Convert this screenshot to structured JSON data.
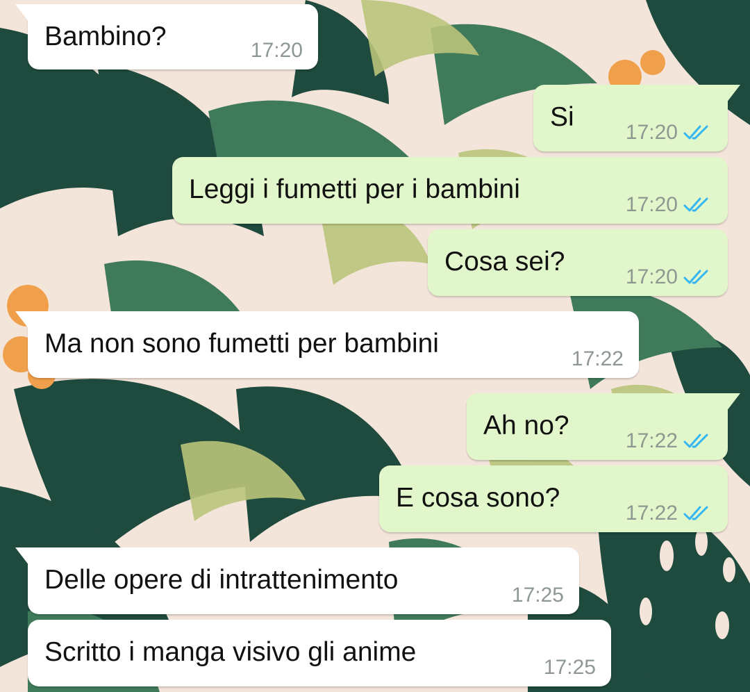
{
  "theme": {
    "incoming_bubble": "#ffffff",
    "outgoing_bubble": "#e1f7cb",
    "read_tick_color": "#34b7f1",
    "timestamp_color": "#8f9890"
  },
  "messages": [
    {
      "direction": "incoming",
      "text": "Bambino?",
      "time": "17:20",
      "status_icon": "double-check-read-icon"
    },
    {
      "direction": "outgoing",
      "text": "Si",
      "time": "17:20",
      "status_icon": "double-check-read-icon"
    },
    {
      "direction": "outgoing",
      "text": "Leggi i fumetti per i bambini",
      "time": "17:20",
      "status_icon": "double-check-read-icon"
    },
    {
      "direction": "outgoing",
      "text": "Cosa sei?",
      "time": "17:20",
      "status_icon": "double-check-read-icon"
    },
    {
      "direction": "incoming",
      "text": "Ma non sono fumetti per bambini",
      "time": "17:22"
    },
    {
      "direction": "outgoing",
      "text": "Ah no?",
      "time": "17:22",
      "status_icon": "double-check-read-icon"
    },
    {
      "direction": "outgoing",
      "text": "E cosa sono?",
      "time": "17:22",
      "status_icon": "double-check-read-icon"
    },
    {
      "direction": "incoming",
      "text": "Delle opere di intrattenimento",
      "time": "17:25"
    },
    {
      "direction": "incoming",
      "text": "Scritto i manga visivo gli anime",
      "time": "17:25"
    }
  ]
}
